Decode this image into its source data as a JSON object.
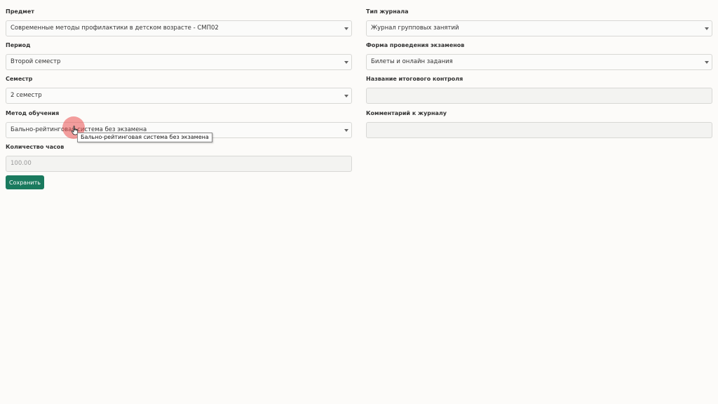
{
  "form": {
    "left": {
      "subject": {
        "label": "Предмет",
        "value": "Современные методы профилактики в детском возрасте - СМП02"
      },
      "period": {
        "label": "Период",
        "value": "Второй семестр"
      },
      "semester": {
        "label": "Семестр",
        "value": "2 семестр"
      },
      "method": {
        "label": "Метод обучения",
        "value": "Бально-рейтинговая система без экзамена"
      },
      "hours": {
        "label": "Количество часов",
        "placeholder": "100.00"
      }
    },
    "right": {
      "journal_type": {
        "label": "Тип журнала",
        "value": "Журнал групповых занятий"
      },
      "exam_form": {
        "label": "Форма проведения экзаменов",
        "value": "Билеты и онлайн задания"
      },
      "final_control_name": {
        "label": "Название итогового контроля",
        "value": ""
      },
      "journal_comment": {
        "label": "Комментарий к журналу",
        "value": ""
      }
    },
    "save_label": "Сохранить"
  },
  "tooltip": {
    "text": "Бально-рейтинговая система без экзамена"
  },
  "colors": {
    "primary_button": "#1a7a5e",
    "click_indicator": "#eb5050",
    "background": "#fcfbf9"
  }
}
